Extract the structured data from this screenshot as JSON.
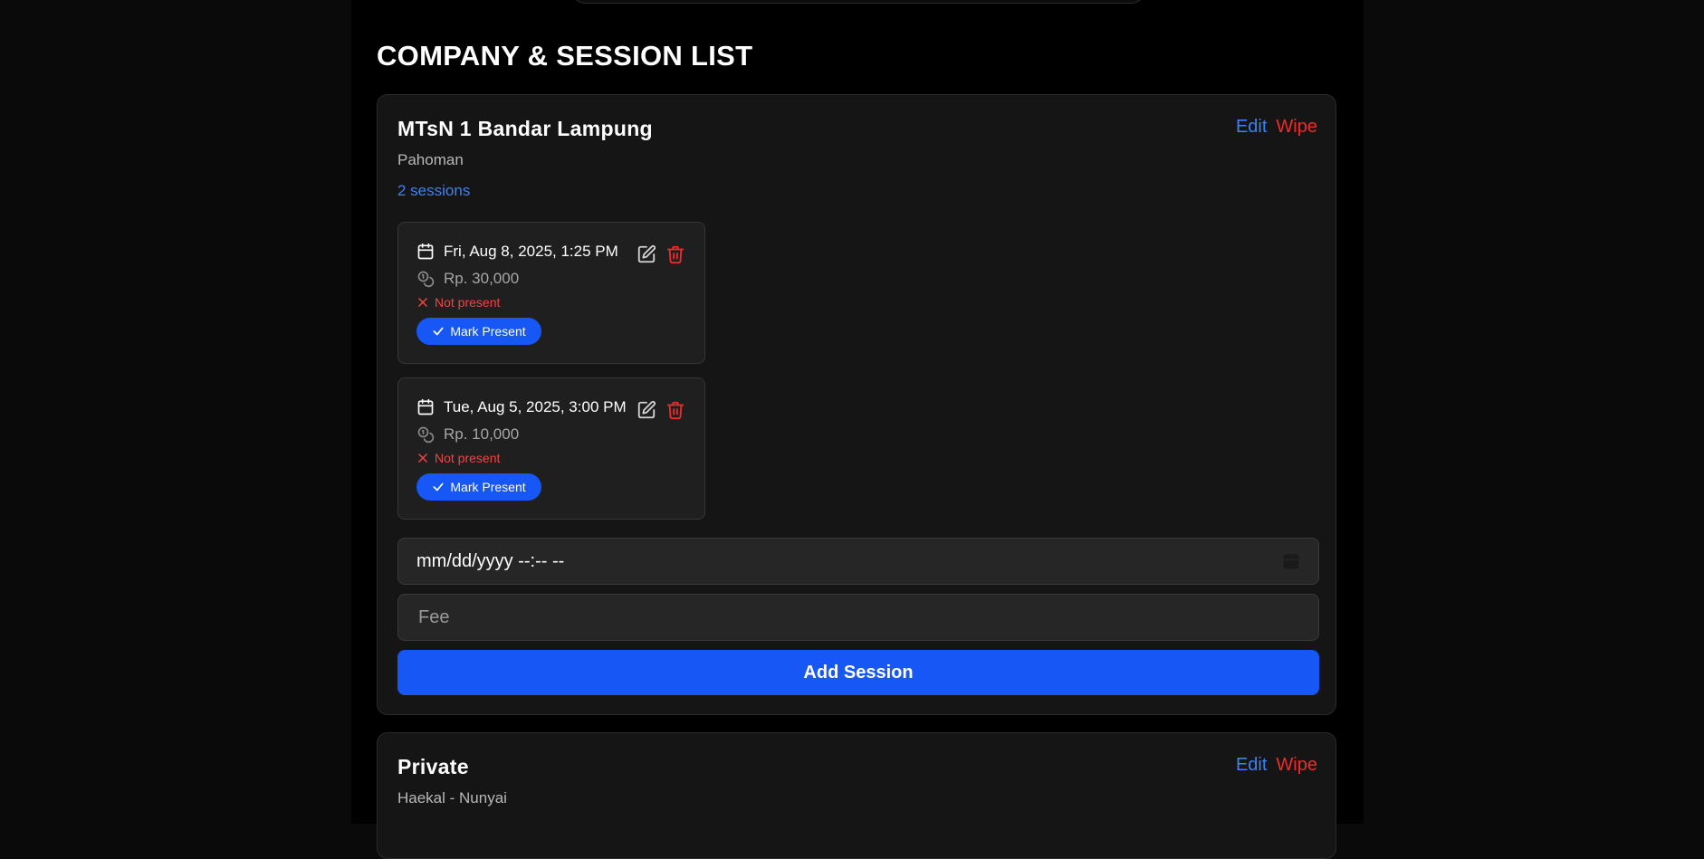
{
  "page": {
    "section_title": "COMPANY & SESSION LIST"
  },
  "companies": [
    {
      "name": "MTsN 1 Bandar Lampung",
      "location": "Pahoman",
      "session_count": "2 sessions",
      "edit_label": "Edit",
      "wipe_label": "Wipe",
      "sessions": [
        {
          "datetime": "Fri, Aug 8, 2025, 1:25 PM",
          "fee": "Rp. 30,000",
          "status": "Not present",
          "mark_label": "Mark Present"
        },
        {
          "datetime": "Tue, Aug 5, 2025, 3:00 PM",
          "fee": "Rp. 10,000",
          "status": "Not present",
          "mark_label": "Mark Present"
        }
      ],
      "new_session": {
        "datetime_value": "mm/dd/yyyy --:-- --",
        "fee_placeholder": "Fee",
        "add_label": "Add Session"
      }
    },
    {
      "name": "Private",
      "location": "Haekal - Nunyai",
      "edit_label": "Edit",
      "wipe_label": "Wipe"
    }
  ],
  "icons": {
    "date": "calendar-icon",
    "fee": "coins-icon",
    "status": "x-icon",
    "mark": "check-icon",
    "edit": "edit-icon",
    "delete": "trash-icon",
    "picker": "calendar-picker-icon"
  },
  "colors": {
    "accent": "#1657f5",
    "link": "#3b82f6",
    "danger": "#ef2b2b",
    "background": "#000000",
    "card": "#151515"
  }
}
